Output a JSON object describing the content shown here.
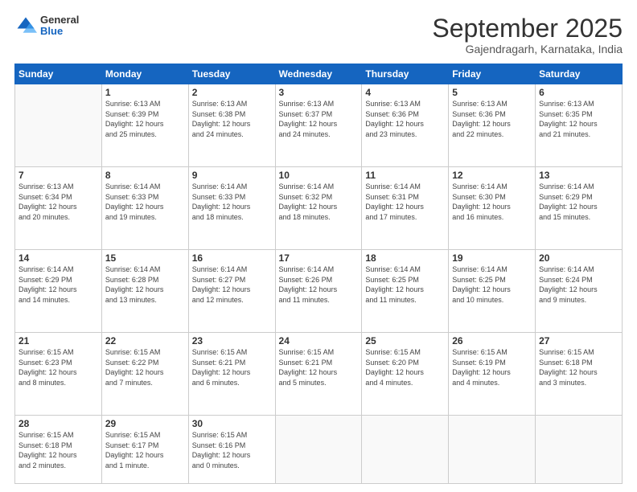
{
  "logo": {
    "general": "General",
    "blue": "Blue"
  },
  "header": {
    "month": "September 2025",
    "location": "Gajendragarh, Karnataka, India"
  },
  "days": [
    "Sunday",
    "Monday",
    "Tuesday",
    "Wednesday",
    "Thursday",
    "Friday",
    "Saturday"
  ],
  "weeks": [
    [
      {
        "date": "",
        "info": ""
      },
      {
        "date": "1",
        "info": "Sunrise: 6:13 AM\nSunset: 6:39 PM\nDaylight: 12 hours\nand 25 minutes."
      },
      {
        "date": "2",
        "info": "Sunrise: 6:13 AM\nSunset: 6:38 PM\nDaylight: 12 hours\nand 24 minutes."
      },
      {
        "date": "3",
        "info": "Sunrise: 6:13 AM\nSunset: 6:37 PM\nDaylight: 12 hours\nand 24 minutes."
      },
      {
        "date": "4",
        "info": "Sunrise: 6:13 AM\nSunset: 6:36 PM\nDaylight: 12 hours\nand 23 minutes."
      },
      {
        "date": "5",
        "info": "Sunrise: 6:13 AM\nSunset: 6:36 PM\nDaylight: 12 hours\nand 22 minutes."
      },
      {
        "date": "6",
        "info": "Sunrise: 6:13 AM\nSunset: 6:35 PM\nDaylight: 12 hours\nand 21 minutes."
      }
    ],
    [
      {
        "date": "7",
        "info": "Sunrise: 6:13 AM\nSunset: 6:34 PM\nDaylight: 12 hours\nand 20 minutes."
      },
      {
        "date": "8",
        "info": "Sunrise: 6:14 AM\nSunset: 6:33 PM\nDaylight: 12 hours\nand 19 minutes."
      },
      {
        "date": "9",
        "info": "Sunrise: 6:14 AM\nSunset: 6:33 PM\nDaylight: 12 hours\nand 18 minutes."
      },
      {
        "date": "10",
        "info": "Sunrise: 6:14 AM\nSunset: 6:32 PM\nDaylight: 12 hours\nand 18 minutes."
      },
      {
        "date": "11",
        "info": "Sunrise: 6:14 AM\nSunset: 6:31 PM\nDaylight: 12 hours\nand 17 minutes."
      },
      {
        "date": "12",
        "info": "Sunrise: 6:14 AM\nSunset: 6:30 PM\nDaylight: 12 hours\nand 16 minutes."
      },
      {
        "date": "13",
        "info": "Sunrise: 6:14 AM\nSunset: 6:29 PM\nDaylight: 12 hours\nand 15 minutes."
      }
    ],
    [
      {
        "date": "14",
        "info": "Sunrise: 6:14 AM\nSunset: 6:29 PM\nDaylight: 12 hours\nand 14 minutes."
      },
      {
        "date": "15",
        "info": "Sunrise: 6:14 AM\nSunset: 6:28 PM\nDaylight: 12 hours\nand 13 minutes."
      },
      {
        "date": "16",
        "info": "Sunrise: 6:14 AM\nSunset: 6:27 PM\nDaylight: 12 hours\nand 12 minutes."
      },
      {
        "date": "17",
        "info": "Sunrise: 6:14 AM\nSunset: 6:26 PM\nDaylight: 12 hours\nand 11 minutes."
      },
      {
        "date": "18",
        "info": "Sunrise: 6:14 AM\nSunset: 6:25 PM\nDaylight: 12 hours\nand 11 minutes."
      },
      {
        "date": "19",
        "info": "Sunrise: 6:14 AM\nSunset: 6:25 PM\nDaylight: 12 hours\nand 10 minutes."
      },
      {
        "date": "20",
        "info": "Sunrise: 6:14 AM\nSunset: 6:24 PM\nDaylight: 12 hours\nand 9 minutes."
      }
    ],
    [
      {
        "date": "21",
        "info": "Sunrise: 6:15 AM\nSunset: 6:23 PM\nDaylight: 12 hours\nand 8 minutes."
      },
      {
        "date": "22",
        "info": "Sunrise: 6:15 AM\nSunset: 6:22 PM\nDaylight: 12 hours\nand 7 minutes."
      },
      {
        "date": "23",
        "info": "Sunrise: 6:15 AM\nSunset: 6:21 PM\nDaylight: 12 hours\nand 6 minutes."
      },
      {
        "date": "24",
        "info": "Sunrise: 6:15 AM\nSunset: 6:21 PM\nDaylight: 12 hours\nand 5 minutes."
      },
      {
        "date": "25",
        "info": "Sunrise: 6:15 AM\nSunset: 6:20 PM\nDaylight: 12 hours\nand 4 minutes."
      },
      {
        "date": "26",
        "info": "Sunrise: 6:15 AM\nSunset: 6:19 PM\nDaylight: 12 hours\nand 4 minutes."
      },
      {
        "date": "27",
        "info": "Sunrise: 6:15 AM\nSunset: 6:18 PM\nDaylight: 12 hours\nand 3 minutes."
      }
    ],
    [
      {
        "date": "28",
        "info": "Sunrise: 6:15 AM\nSunset: 6:18 PM\nDaylight: 12 hours\nand 2 minutes."
      },
      {
        "date": "29",
        "info": "Sunrise: 6:15 AM\nSunset: 6:17 PM\nDaylight: 12 hours\nand 1 minute."
      },
      {
        "date": "30",
        "info": "Sunrise: 6:15 AM\nSunset: 6:16 PM\nDaylight: 12 hours\nand 0 minutes."
      },
      {
        "date": "",
        "info": ""
      },
      {
        "date": "",
        "info": ""
      },
      {
        "date": "",
        "info": ""
      },
      {
        "date": "",
        "info": ""
      }
    ]
  ]
}
